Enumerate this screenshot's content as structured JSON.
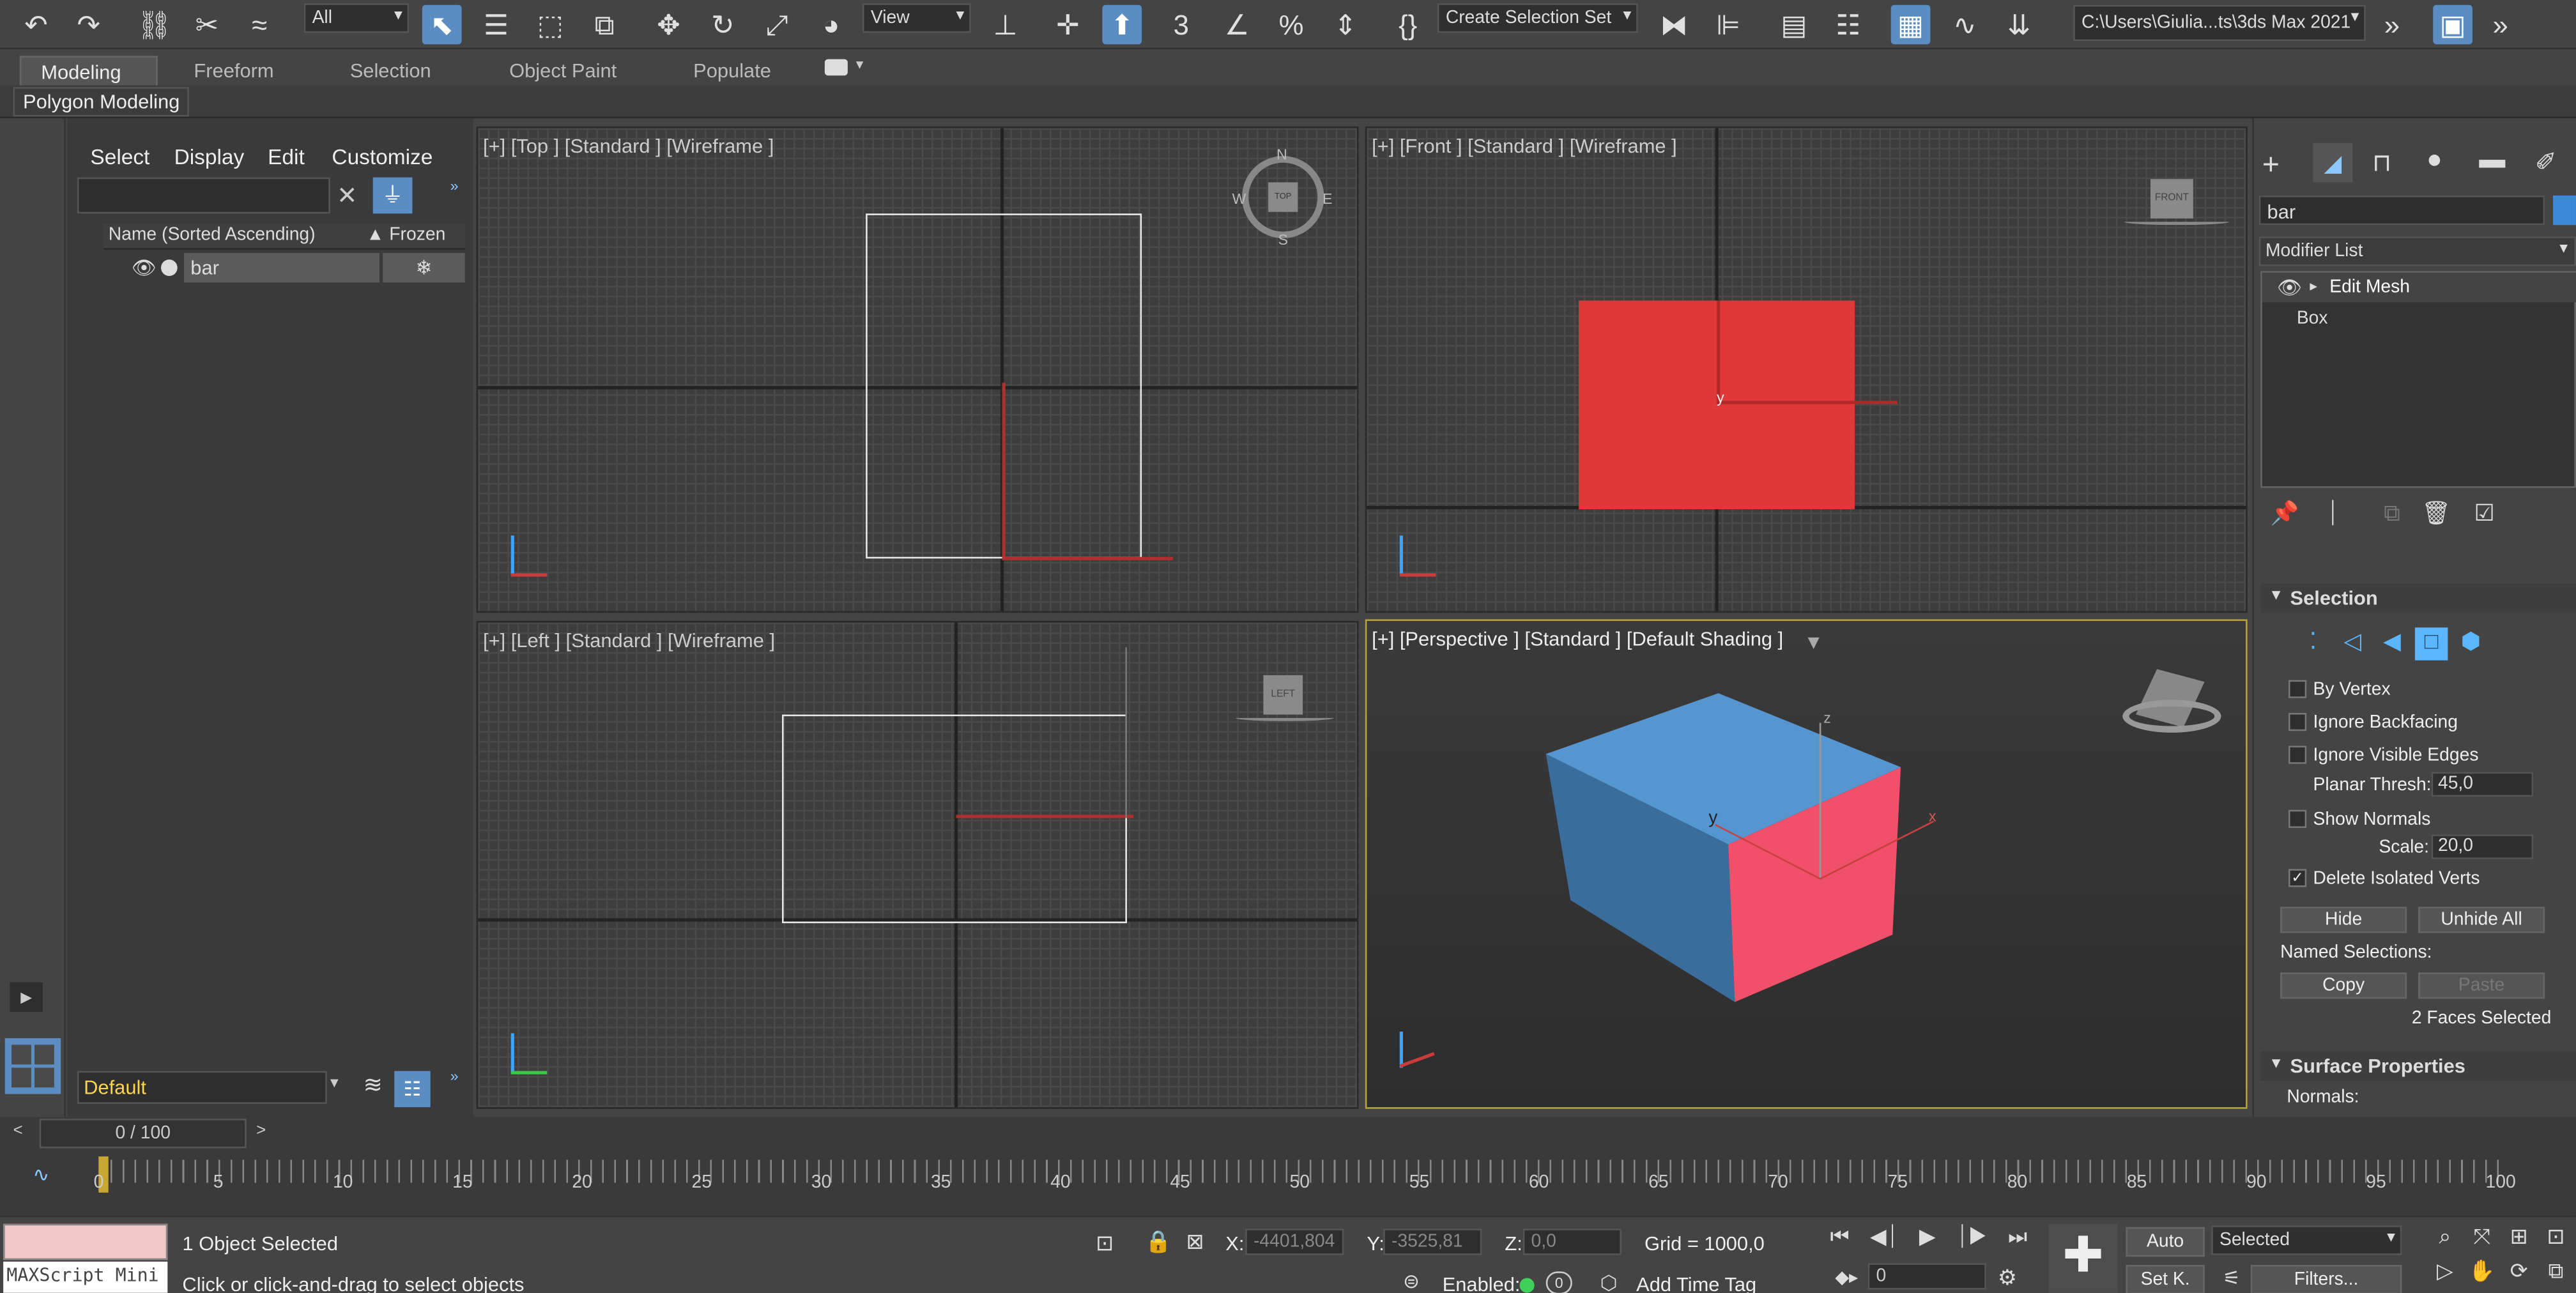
{
  "toolbar": {
    "selection_filter": "All",
    "ref_coord": "View",
    "named_selection": "Create Selection Set",
    "project_path": "C:\\Users\\Giulia...ts\\3ds Max 2021"
  },
  "ribbon": {
    "tabs": [
      "Modeling",
      "Freeform",
      "Selection",
      "Object Paint",
      "Populate"
    ],
    "active_tab": "Modeling",
    "panel_label": "Polygon Modeling"
  },
  "explorer": {
    "menu": [
      "Select",
      "Display",
      "Edit",
      "Customize"
    ],
    "search_value": "",
    "col_name": "Name (Sorted Ascending)",
    "col_frozen": "▲ Frozen",
    "items": [
      {
        "name": "bar"
      }
    ],
    "layer": "Default"
  },
  "viewports": {
    "top": "[+] [Top ] [Standard ] [Wireframe ]",
    "front": "[+] [Front ] [Standard ] [Wireframe ]",
    "left": "[+] [Left ] [Standard ] [Wireframe ]",
    "perspective": "[+] [Perspective ] [Standard ] [Default Shading ]",
    "compass": {
      "n": "N",
      "s": "S",
      "e": "E",
      "w": "W",
      "center": "TOP"
    },
    "cube_front": "FRONT",
    "cube_left": "LEFT",
    "axis_labels": {
      "x": "x",
      "y": "y",
      "z": "z"
    }
  },
  "command_panel": {
    "object_name": "bar",
    "modifier_list": "Modifier List",
    "stack": [
      "Edit Mesh",
      "Box"
    ],
    "selection_title": "Selection",
    "by_vertex": "By Vertex",
    "ignore_backfacing": "Ignore Backfacing",
    "ignore_visible_edges": "Ignore Visible Edges",
    "planar_thresh_label": "Planar Thresh:",
    "planar_thresh_value": "45,0",
    "show_normals": "Show Normals",
    "scale_label": "Scale:",
    "scale_value": "20,0",
    "delete_isolated": "Delete Isolated Verts",
    "delete_isolated_checked": true,
    "hide": "Hide",
    "unhide_all": "Unhide All",
    "named_selections": "Named Selections:",
    "copy": "Copy",
    "paste": "Paste",
    "faces_selected": "2 Faces Selected",
    "surface_title": "Surface Properties",
    "normals": "Normals:"
  },
  "timeline": {
    "frame": "0 / 100",
    "ticks": [
      "0",
      "5",
      "10",
      "15",
      "20",
      "25",
      "30",
      "35",
      "40",
      "45",
      "50",
      "55",
      "60",
      "65",
      "70",
      "75",
      "80",
      "85",
      "90",
      "95",
      "100"
    ]
  },
  "status": {
    "maxscript": "MAXScript Mini",
    "selected": "1 Object Selected",
    "prompt": "Click or click-and-drag to select objects",
    "x_label": "X:",
    "x_value": "-4401,804",
    "y_label": "Y:",
    "y_value": "-3525,81",
    "z_label": "Z:",
    "z_value": "0,0",
    "grid": "Grid = 1000,0",
    "enabled": "Enabled:",
    "add_time_tag": "Add Time Tag",
    "auto": "Auto",
    "set_key": "Set K.",
    "selected_dd": "Selected",
    "filters": "Filters...",
    "current_frame": "0"
  },
  "colors": {
    "accent": "#5b8dc2",
    "box_red": "#e03838",
    "box_top": "#5596d0",
    "box_side": "#3a6c9c",
    "box_face_selected": "#f0506a",
    "active_viewport_border": "#b8a23a"
  }
}
